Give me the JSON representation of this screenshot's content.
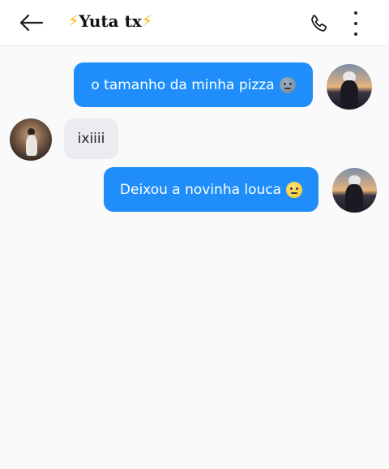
{
  "header": {
    "title": "Yuta tx",
    "title_prefix_emoji": "⚡",
    "title_suffix_emoji": "⚡",
    "back_icon": "arrow-left-icon",
    "call_icon": "phone-icon",
    "menu_icon": "more-vertical-icon"
  },
  "messages": [
    {
      "direction": "outgoing",
      "text": "o tamanho da minha pizza",
      "emoji": "cold-face-emoji"
    },
    {
      "direction": "incoming",
      "text": "ixiiii"
    },
    {
      "direction": "outgoing",
      "text": "Deixou a novinha louca",
      "emoji": "flushed-face-emoji"
    }
  ],
  "colors": {
    "outgoing_bubble": "#1f8efa",
    "incoming_bubble": "#ececf0",
    "background": "#fafafa",
    "bolt": "#f7b500"
  }
}
